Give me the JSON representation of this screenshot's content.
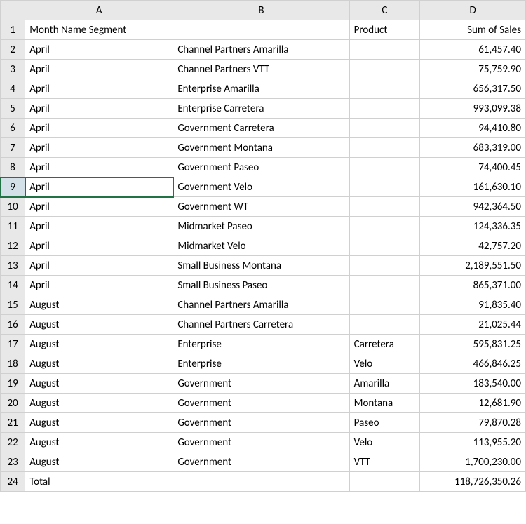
{
  "columns": [
    "A",
    "B",
    "C",
    "D"
  ],
  "rowCount": 24,
  "selectedRow": 9,
  "selectedCell": "A9",
  "headers": {
    "A": "Month Name Segment",
    "B": "",
    "C": "Product",
    "D": "Sum of Sales"
  },
  "rows": [
    {
      "A": "April",
      "B": "Channel Partners Amarilla",
      "C": "",
      "D": "61,457.40"
    },
    {
      "A": "April",
      "B": "Channel Partners VTT",
      "C": "",
      "D": "75,759.90"
    },
    {
      "A": "April",
      "B": "Enterprise Amarilla",
      "C": "",
      "D": "656,317.50"
    },
    {
      "A": "April",
      "B": "Enterprise Carretera",
      "C": "",
      "D": "993,099.38"
    },
    {
      "A": "April",
      "B": "Government Carretera",
      "C": "",
      "D": "94,410.80"
    },
    {
      "A": "April",
      "B": "Government Montana",
      "C": "",
      "D": "683,319.00"
    },
    {
      "A": "April",
      "B": "Government Paseo",
      "C": "",
      "D": "74,400.45"
    },
    {
      "A": "April",
      "B": "Government Velo",
      "C": "",
      "D": "161,630.10"
    },
    {
      "A": "April",
      "B": "Government WT",
      "C": "",
      "D": "942,364.50"
    },
    {
      "A": "April",
      "B": "Midmarket Paseo",
      "C": "",
      "D": "124,336.35"
    },
    {
      "A": "April",
      "B": "Midmarket Velo",
      "C": "",
      "D": "42,757.20"
    },
    {
      "A": "April",
      "B": "Small Business Montana",
      "C": "",
      "D": "2,189,551.50"
    },
    {
      "A": "April",
      "B": "Small Business Paseo",
      "C": "",
      "D": "865,371.00"
    },
    {
      "A": "August",
      "B": "Channel Partners Amarilla",
      "C": "",
      "D": "91,835.40"
    },
    {
      "A": "August",
      "B": "Channel Partners Carretera",
      "C": "",
      "D": "21,025.44"
    },
    {
      "A": "August",
      "B": "Enterprise",
      "C": "Carretera",
      "D": "595,831.25"
    },
    {
      "A": "August",
      "B": "Enterprise",
      "C": "Velo",
      "D": "466,846.25"
    },
    {
      "A": "August",
      "B": "Government",
      "C": "Amarilla",
      "D": "183,540.00"
    },
    {
      "A": "August",
      "B": "Government",
      "C": "Montana",
      "D": "12,681.90"
    },
    {
      "A": "August",
      "B": "Government",
      "C": "Paseo",
      "D": "79,870.28"
    },
    {
      "A": "August",
      "B": "Government",
      "C": "Velo",
      "D": "113,955.20"
    },
    {
      "A": "August",
      "B": "Government",
      "C": "VTT",
      "D": "1,700,230.00"
    },
    {
      "A": "Total",
      "B": "",
      "C": "",
      "D": "118,726,350.26"
    }
  ]
}
